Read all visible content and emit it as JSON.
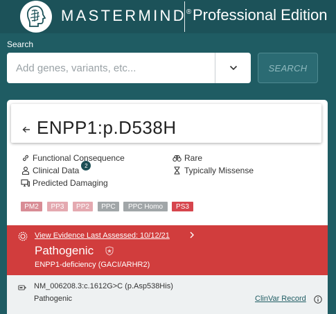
{
  "header": {
    "brand": "MASTERMIND",
    "brand_mark": "®",
    "edition": "Professional Edition",
    "logo_icon": "brain-logo-icon"
  },
  "search": {
    "label": "Search",
    "placeholder": "Add genes, variants, etc...",
    "value": "",
    "button_label": "SEARCH",
    "dropdown_icon": "chevron-down-icon"
  },
  "variant": {
    "title": "ENPP1:p.D538H",
    "back_icon": "arrow-left-icon",
    "features": [
      {
        "label": "Functional Consequence",
        "icon": "link-icon"
      },
      {
        "label": "Rare",
        "icon": "binoculars-icon"
      },
      {
        "label": "Clinical Data",
        "icon": "person-icon",
        "count": "2"
      },
      {
        "label": "Typically Missense",
        "icon": "hourglass-icon"
      },
      {
        "label": "Predicted Damaging",
        "icon": "computer-icon"
      }
    ],
    "acmg_tags": [
      {
        "label": "PM2",
        "color": "#d88c95"
      },
      {
        "label": "PP3",
        "color": "#e4a9b0"
      },
      {
        "label": "PP2",
        "color": "#e4a9b0"
      },
      {
        "label": "PPC",
        "color": "#a1a6a8"
      },
      {
        "label": "PPC Homo",
        "color": "#a1a6a8"
      },
      {
        "label": "PS3",
        "color": "#d6454d"
      }
    ]
  },
  "assessment": {
    "link": "View Evidence Last Assessed: 10/12/21",
    "classification": "Pathogenic",
    "condition": "ENPP1-deficiency (GACI/ARHR2)",
    "color": "#d13d3d"
  },
  "clinvar": {
    "hgvs": "NM_006208.3:c.1612G>C (p.Asp538His)",
    "classification": "Pathogenic",
    "link": "ClinVar Record"
  }
}
